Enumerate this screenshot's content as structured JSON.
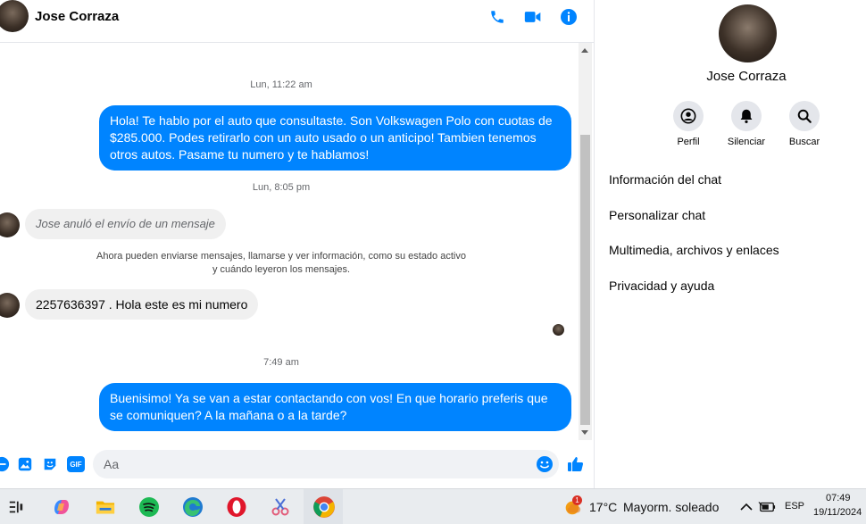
{
  "header": {
    "name": "Jose Corraza",
    "icons": [
      "phone-icon",
      "video-icon",
      "info-icon"
    ]
  },
  "thread": {
    "ts1": "Lun, 11:22 am",
    "msg1": "Hola! Te hablo por el auto que consultaste. Son Volkswagen Polo con cuotas de $285.000. Podes retirarlo con un auto usado o un anticipo! Tambien tenemos otros autos. Pasame tu numero y te hablamos!",
    "ts2": "Lun, 8:05 pm",
    "unsent": "Jose anuló el envío de un mensaje",
    "sys_line1": "Ahora pueden enviarse mensajes, llamarse y ver información, como su estado activo",
    "sys_line2": "y cuándo leyeron los mensajes.",
    "msg2": "2257636397 . Hola este es mi numero",
    "ts3": "7:49 am",
    "msg3": "Buenisimo! Ya se van a estar contactando con vos! En que horario preferis que se comuniquen? A la mañana o a la tarde?"
  },
  "composer": {
    "placeholder": "Aa",
    "gif_label": "GIF"
  },
  "info_panel": {
    "name": "Jose Corraza",
    "actions": [
      {
        "label": "Perfil",
        "icon": "profile-icon"
      },
      {
        "label": "Silenciar",
        "icon": "bell-icon"
      },
      {
        "label": "Buscar",
        "icon": "search-icon"
      }
    ],
    "menu": [
      "Información del chat",
      "Personalizar chat",
      "Multimedia, archivos y enlaces",
      "Privacidad y ayuda"
    ]
  },
  "taskbar": {
    "weather_temp": "17°C",
    "weather_desc": "Mayorm. soleado",
    "weather_badge": "1",
    "lang": "ESP",
    "time": "07:49",
    "date": "19/11/2024"
  },
  "colors": {
    "accent": "#0084ff",
    "bubble_in": "#f0f0f0"
  }
}
